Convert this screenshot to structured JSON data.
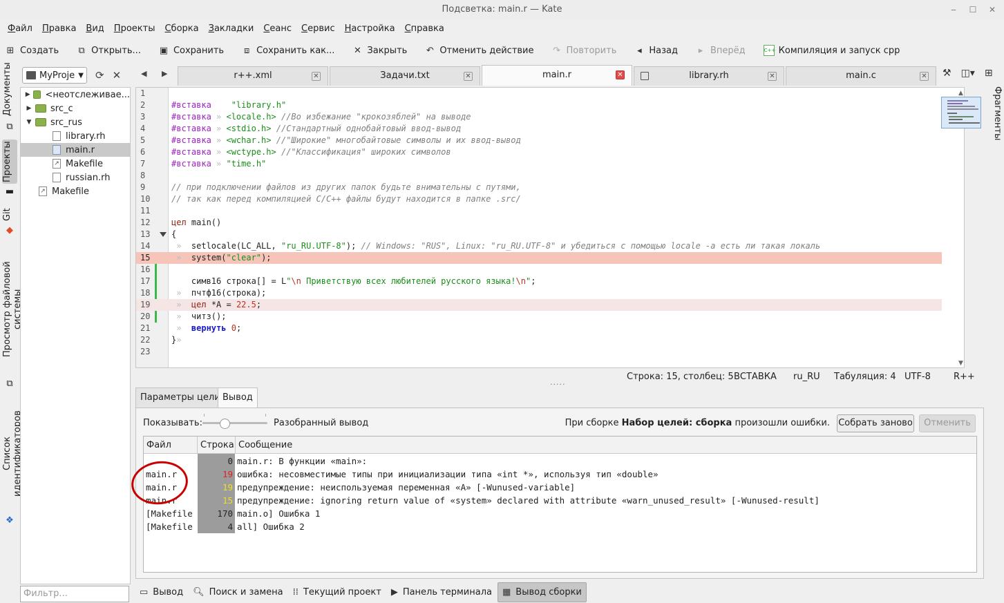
{
  "window": {
    "title": "Подсветка: main.r — Kate"
  },
  "menu": [
    "Файл",
    "Правка",
    "Вид",
    "Проекты",
    "Сборка",
    "Закладки",
    "Сеанс",
    "Сервис",
    "Настройка",
    "Справка"
  ],
  "toolbar": {
    "new": "Создать",
    "open": "Открыть...",
    "save": "Сохранить",
    "save_as": "Сохранить как...",
    "close": "Закрыть",
    "undo": "Отменить действие",
    "redo": "Повторить",
    "back": "Назад",
    "forward": "Вперёд",
    "compile": "Компиляция и запуск cpp",
    "cpp_icon": "C++"
  },
  "left_tabs": {
    "documents": "Документы",
    "projects": "Проекты",
    "git": "Git",
    "fs_browser": "Просмотр файловой системы",
    "symbols": "Список идентификаторов"
  },
  "project": {
    "selector": "MyProje",
    "tree": [
      {
        "label": "<неотслеживае...",
        "depth": 0,
        "type": "folder",
        "expanded": false
      },
      {
        "label": "src_c",
        "depth": 0,
        "type": "folder",
        "expanded": false
      },
      {
        "label": "src_rus",
        "depth": 0,
        "type": "folder",
        "expanded": true
      },
      {
        "label": "library.rh",
        "depth": 1,
        "type": "file"
      },
      {
        "label": "main.r",
        "depth": 1,
        "type": "rfile",
        "selected": true
      },
      {
        "label": "Makefile",
        "depth": 1,
        "type": "make"
      },
      {
        "label": "russian.rh",
        "depth": 1,
        "type": "file"
      },
      {
        "label": "Makefile",
        "depth": -1,
        "type": "make"
      }
    ],
    "filter_placeholder": "Фильтр..."
  },
  "tabs": [
    {
      "label": "r++.xml"
    },
    {
      "label": "Задачи.txt"
    },
    {
      "label": "main.r",
      "active": true
    },
    {
      "label": "library.rh",
      "modified": true
    },
    {
      "label": "main.c"
    }
  ],
  "right_tabs": {
    "snippets": "Фрагменты"
  },
  "code": [
    [],
    [
      {
        "t": "#вставка",
        "c": "k-pp"
      },
      {
        "t": "    "
      },
      {
        "t": "\"library.h\"",
        "c": "k-str"
      }
    ],
    [
      {
        "t": "#вставка",
        "c": "k-pp"
      },
      {
        "t": " » ",
        "c": "tabm"
      },
      {
        "t": "<locale.h>",
        "c": "k-str"
      },
      {
        "t": " "
      },
      {
        "t": "//Во избежание \"крокозяблей\" на выводе",
        "c": "k-com"
      }
    ],
    [
      {
        "t": "#вставка",
        "c": "k-pp"
      },
      {
        "t": " » ",
        "c": "tabm"
      },
      {
        "t": "<stdio.h>",
        "c": "k-str"
      },
      {
        "t": " "
      },
      {
        "t": "//Стандартный однобайтовый ввод-вывод",
        "c": "k-com"
      }
    ],
    [
      {
        "t": "#вставка",
        "c": "k-pp"
      },
      {
        "t": " » ",
        "c": "tabm"
      },
      {
        "t": "<wchar.h>",
        "c": "k-str"
      },
      {
        "t": " "
      },
      {
        "t": "//\"Широкие\" многобайтовые символы и их ввод-вывод",
        "c": "k-com"
      }
    ],
    [
      {
        "t": "#вставка",
        "c": "k-pp"
      },
      {
        "t": " » ",
        "c": "tabm"
      },
      {
        "t": "<wctype.h>",
        "c": "k-str"
      },
      {
        "t": " "
      },
      {
        "t": "//\"Классификация\" широких символов",
        "c": "k-com"
      }
    ],
    [
      {
        "t": "#вставка",
        "c": "k-pp"
      },
      {
        "t": " » ",
        "c": "tabm"
      },
      {
        "t": "\"time.h\"",
        "c": "k-str"
      }
    ],
    [],
    [
      {
        "t": "// при подключении файлов из других папок будьте внимательны с путями,",
        "c": "k-com"
      }
    ],
    [
      {
        "t": "// так как перед компиляцией C/C++ файлы будут находится в папке .src/",
        "c": "k-com"
      }
    ],
    [],
    [
      {
        "t": "цел",
        "c": "k-type"
      },
      {
        "t": " main()"
      }
    ],
    [
      {
        "t": "{"
      }
    ],
    [
      {
        "t": " »  ",
        "c": "tabm"
      },
      {
        "t": "setlocale(LC_ALL, "
      },
      {
        "t": "\"ru_RU.UTF-8\"",
        "c": "k-str"
      },
      {
        "t": "); "
      },
      {
        "t": "// Windows: \"RUS\", Linux: \"ru_RU.UTF-8\" и убедиться с помощью locale -a есть ли такая локаль",
        "c": "k-com"
      }
    ],
    [
      {
        "t": " »  ",
        "c": "tabm"
      },
      {
        "t": "system("
      },
      {
        "t": "\"clear\"",
        "c": "k-str"
      },
      {
        "t": ");"
      }
    ],
    [],
    [
      {
        "t": "    "
      },
      {
        "t": "симв16 строка[] = L"
      },
      {
        "t": "\"",
        "c": "k-str"
      },
      {
        "t": "\\n",
        "c": "k-esc"
      },
      {
        "t": " Приветствую всех любителей русского языка!",
        "c": "k-str"
      },
      {
        "t": "\\n",
        "c": "k-esc"
      },
      {
        "t": "\"",
        "c": "k-str"
      },
      {
        "t": ";"
      }
    ],
    [
      {
        "t": " »  ",
        "c": "tabm"
      },
      {
        "t": "пчтф16(строка);"
      }
    ],
    [
      {
        "t": " »  ",
        "c": "tabm"
      },
      {
        "t": "цел",
        "c": "k-type"
      },
      {
        "t": " *A = "
      },
      {
        "t": "22.5",
        "c": "k-num"
      },
      {
        "t": ";"
      }
    ],
    [
      {
        "t": " »  ",
        "c": "tabm"
      },
      {
        "t": "читз();"
      }
    ],
    [
      {
        "t": " »  ",
        "c": "tabm"
      },
      {
        "t": "вернуть",
        "c": "k-ret"
      },
      {
        "t": " "
      },
      {
        "t": "0",
        "c": "k-num"
      },
      {
        "t": ";"
      }
    ],
    [
      {
        "t": "}"
      },
      {
        "t": "»",
        "c": "tabm"
      }
    ],
    []
  ],
  "status": {
    "position": "Строка: 15, столбец: 5",
    "mode": "ВСТАВКА",
    "lang": "ru_RU",
    "tabs": "Табуляция: 4",
    "encoding": "UTF-8",
    "syntax": "R++"
  },
  "output_tabs": {
    "target": "Параметры цели",
    "output": "Вывод"
  },
  "output": {
    "show_label": "Показывать:",
    "parsed_label": "Разобранный вывод",
    "build_msg_pre": "При сборке ",
    "build_msg_bold": "Набор целей: сборка",
    "build_msg_post": " произошли ошибки.",
    "rebuild": "Собрать заново",
    "cancel": "Отменить",
    "columns": [
      "Файл",
      "Строка",
      "Сообщение"
    ],
    "rows": [
      {
        "file": "",
        "line": "0",
        "msg": "main.r: В функции «main»:",
        "lc": ""
      },
      {
        "file": "main.r",
        "line": "19",
        "msg": "ошибка: несовместимые типы при инициализации типа «int *», используя тип «double»",
        "lc": "red"
      },
      {
        "file": "main.r",
        "line": "19",
        "msg": "предупреждение: неиспользуемая переменная «A» [-Wunused-variable]",
        "lc": "yel"
      },
      {
        "file": "main.r",
        "line": "15",
        "msg": "предупреждение: ignoring return value of «system» declared with attribute «warn_unused_result» [-Wunused-result]",
        "lc": "yel"
      },
      {
        "file": "[Makefile",
        "line": "170",
        "msg": "main.o] Ошибка 1",
        "lc": ""
      },
      {
        "file": "[Makefile",
        "line": "4",
        "msg": "all] Ошибка 2",
        "lc": ""
      }
    ]
  },
  "bottom_tabs": {
    "output": "Вывод",
    "search": "Поиск и замена",
    "project": "Текущий проект",
    "terminal": "Панель терминала",
    "build": "Вывод сборки"
  }
}
